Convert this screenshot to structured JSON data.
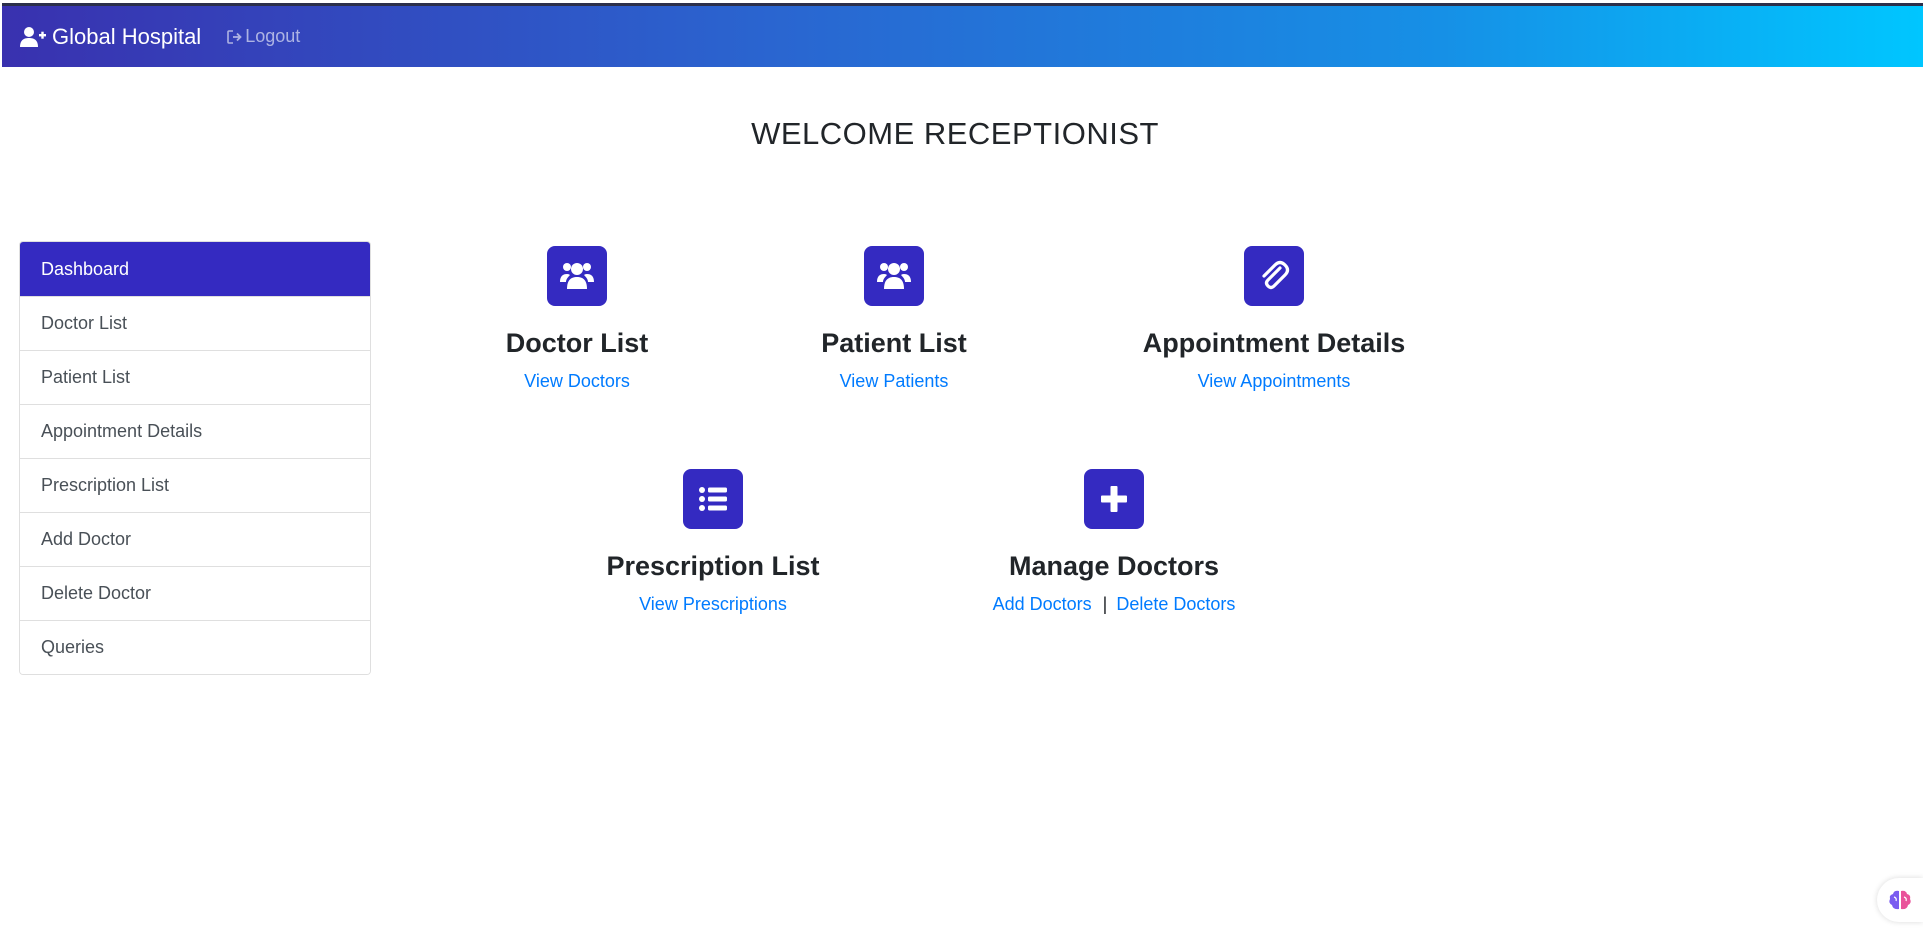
{
  "navbar": {
    "brand": "Global Hospital",
    "logout": "Logout"
  },
  "page_title": "WELCOME RECEPTIONIST",
  "sidebar": {
    "items": [
      {
        "label": "Dashboard",
        "active": true
      },
      {
        "label": "Doctor List"
      },
      {
        "label": "Patient List"
      },
      {
        "label": "Appointment Details"
      },
      {
        "label": "Prescription List"
      },
      {
        "label": "Add Doctor"
      },
      {
        "label": "Delete Doctor"
      },
      {
        "label": "Queries"
      }
    ]
  },
  "tiles": {
    "doctor_list": {
      "icon": "users-icon",
      "title": "Doctor List",
      "link": "View Doctors"
    },
    "patient_list": {
      "icon": "users-icon",
      "title": "Patient List",
      "link": "View Patients"
    },
    "appointment_details": {
      "icon": "paperclip-icon",
      "title": "Appointment Details",
      "link": "View Appointments"
    },
    "prescription_list": {
      "icon": "list-icon",
      "title": "Prescription List",
      "link": "View Prescriptions"
    },
    "manage_doctors": {
      "icon": "plus-icon",
      "title": "Manage Doctors",
      "link_add": "Add Doctors",
      "separator": "|",
      "link_delete": "Delete Doctors"
    }
  },
  "colors": {
    "accent": "#342ac1",
    "link": "#007bff",
    "navbar_start": "#3931af",
    "navbar_end": "#00c6ff"
  }
}
